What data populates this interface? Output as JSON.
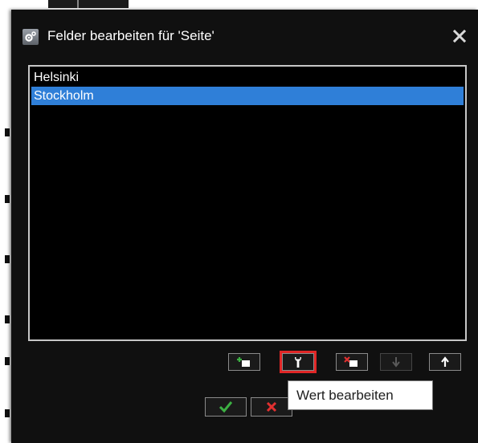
{
  "dialog": {
    "title": "Felder bearbeiten für 'Seite'",
    "title_icon": "gear-icon",
    "close_icon": "close-icon"
  },
  "list": {
    "items": [
      {
        "label": "Helsinki",
        "selected": false
      },
      {
        "label": "Stockholm",
        "selected": true
      }
    ]
  },
  "toolbar": {
    "buttons": [
      {
        "name": "add-field-button",
        "icon": "add-field-icon",
        "enabled": true
      },
      {
        "name": "edit-value-button",
        "icon": "wrench-icon",
        "enabled": true,
        "highlighted": true
      },
      {
        "name": "delete-field-button",
        "icon": "delete-field-icon",
        "enabled": true
      },
      {
        "name": "move-down-button",
        "icon": "arrow-down-icon",
        "enabled": false
      },
      {
        "name": "move-up-button",
        "icon": "arrow-up-icon",
        "enabled": true
      }
    ]
  },
  "actions": {
    "ok_icon": "checkmark-icon",
    "cancel_icon": "cross-icon"
  },
  "tooltip": {
    "text": "Wert bearbeiten"
  },
  "colors": {
    "dialog_bg": "#101010",
    "selection": "#2f7fd8",
    "highlight": "#e02626",
    "ok_green": "#3cb043",
    "cancel_red": "#e03030"
  }
}
